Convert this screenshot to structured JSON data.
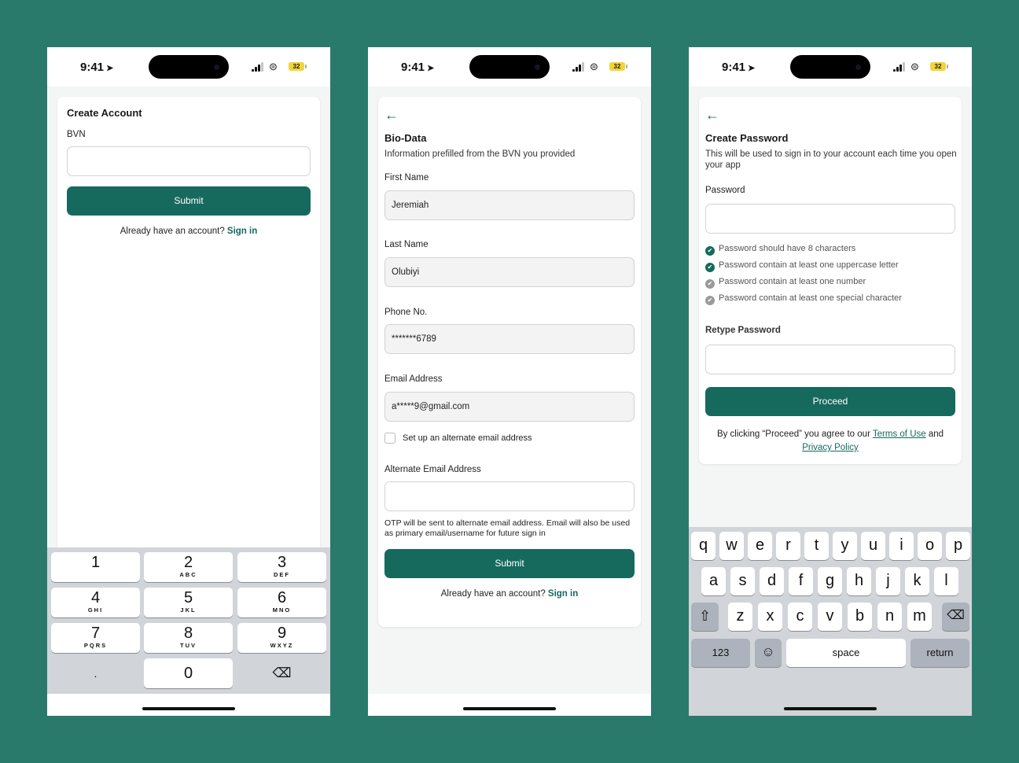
{
  "status": {
    "time": "9:41",
    "battery": "32"
  },
  "screen1": {
    "title": "Create Account",
    "bvn_label": "BVN",
    "bvn_value": "",
    "submit": "Submit",
    "have_account": "Already have an account?",
    "sign_in": "Sign in",
    "numpad": [
      {
        "d": "1",
        "l": ""
      },
      {
        "d": "2",
        "l": "ABC"
      },
      {
        "d": "3",
        "l": "DEF"
      },
      {
        "d": "4",
        "l": "GHI"
      },
      {
        "d": "5",
        "l": "JKL"
      },
      {
        "d": "6",
        "l": "MNO"
      },
      {
        "d": "7",
        "l": "PQRS"
      },
      {
        "d": "8",
        "l": "TUV"
      },
      {
        "d": "9",
        "l": "WXYZ"
      },
      {
        "d": ".",
        "l": ""
      },
      {
        "d": "0",
        "l": ""
      },
      {
        "d": "⌫",
        "l": ""
      }
    ]
  },
  "screen2": {
    "back": "←",
    "title": "Bio-Data",
    "subtitle": "Information prefilled from the  BVN you provided",
    "first_name_label": "First Name",
    "first_name": "Jeremiah",
    "last_name_label": "Last Name",
    "last_name": "Olubiyi",
    "phone_label": "Phone No.",
    "phone": "*******6789",
    "email_label": "Email Address",
    "email": "a*****9@gmail.com",
    "alt_checkbox_label": "Set up an alternate email address",
    "alt_email_label": "Alternate Email Address",
    "alt_email": "",
    "otp_note": "OTP will be sent to alternate email address. Email will also be used as primary email/username for future sign in",
    "submit": "Submit",
    "have_account": "Already have an account?",
    "sign_in": "Sign in"
  },
  "screen3": {
    "back": "←",
    "title": "Create Password",
    "subtitle": "This will be used to sign in to your account each time you open your app",
    "password_label": "Password",
    "requirements": [
      {
        "text": "Password should have 8 characters",
        "met": true
      },
      {
        "text": "Password contain at least one uppercase letter",
        "met": true
      },
      {
        "text": "Password contain at least one number",
        "met": false
      },
      {
        "text": "Password contain at least one special character",
        "met": false
      }
    ],
    "retype_label": "Retype Password",
    "proceed": "Proceed",
    "terms_prefix": "By clicking “Proceed” you agree to our",
    "terms_link": "Terms of Use",
    "and": "and",
    "privacy_link": "Privacy Policy",
    "keyboard": {
      "row1": [
        "q",
        "w",
        "e",
        "r",
        "t",
        "y",
        "u",
        "i",
        "o",
        "p"
      ],
      "row2": [
        "a",
        "s",
        "d",
        "f",
        "g",
        "h",
        "j",
        "k",
        "l"
      ],
      "row3": [
        "z",
        "x",
        "c",
        "v",
        "b",
        "n",
        "m"
      ],
      "numbers": "123",
      "space": "space",
      "return": "return"
    }
  },
  "colors": {
    "primary": "#16695d",
    "background": "#2a7a6c",
    "check_on": "#16695d",
    "check_off": "#9a9a9a"
  }
}
